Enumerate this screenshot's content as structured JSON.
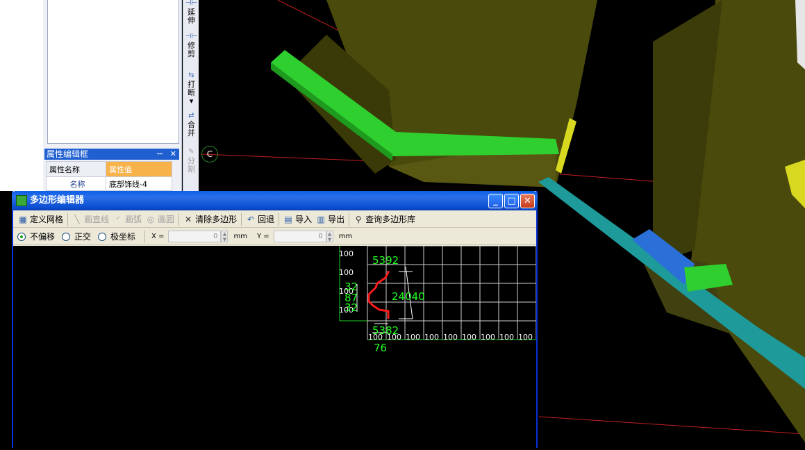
{
  "left_panel": {
    "prop_title": "属性编辑框",
    "prop_pin": "ᅲ",
    "prop_close": "✕",
    "table_headers": [
      "属性名称",
      "属性值"
    ],
    "rows": [
      {
        "name": "名称",
        "value": "底部饰线-4"
      }
    ]
  },
  "vertical_tools": [
    {
      "icon": "extend-icon",
      "label": "延\n伸",
      "disabled": false
    },
    {
      "icon": "trim-icon",
      "label": "修\n剪",
      "disabled": false
    },
    {
      "icon": "break-icon",
      "label": "打\n断\n▾",
      "disabled": false
    },
    {
      "icon": "merge-icon",
      "label": "合\n并",
      "disabled": false
    },
    {
      "icon": "split-icon",
      "label": "分\n割",
      "disabled": true
    }
  ],
  "osnap_label": "C",
  "dialog": {
    "title": "多边形编辑器",
    "toolbar": [
      {
        "label": "定义网格",
        "icon": "grid-icon",
        "disabled": false
      },
      {
        "label": "画直线",
        "icon": "line-icon",
        "disabled": true
      },
      {
        "label": "画弧",
        "icon": "arc-icon",
        "disabled": true
      },
      {
        "label": "画圆",
        "icon": "circle-icon",
        "disabled": true
      },
      {
        "label": "清除多边形",
        "icon": "clear-icon",
        "disabled": false
      },
      {
        "label": "回退",
        "icon": "undo-icon",
        "disabled": false
      },
      {
        "label": "导入",
        "icon": "import-icon",
        "disabled": false
      },
      {
        "label": "导出",
        "icon": "export-icon",
        "disabled": false
      },
      {
        "label": "查询多边形库",
        "icon": "search-icon",
        "disabled": false
      }
    ],
    "options": {
      "radios": [
        {
          "label": "不偏移",
          "checked": true
        },
        {
          "label": "正交",
          "checked": false
        },
        {
          "label": "极坐标",
          "checked": false
        }
      ],
      "x_label": "X =",
      "x_value": "0",
      "y_label": "Y =",
      "y_value": "0",
      "unit": "mm"
    },
    "canvas": {
      "grid_spacing_labels_x": [
        "100",
        "100",
        "100",
        "100",
        "100",
        "100",
        "100",
        "100",
        "100"
      ],
      "grid_spacing_labels_y": [
        "100",
        "100",
        "100",
        "100"
      ],
      "dim_top": "5392",
      "dim_left": [
        "32",
        "87",
        "32"
      ],
      "dim_right": "24040",
      "dim_bottom_a": "5382",
      "dim_bottom_b": "76"
    }
  },
  "colors": {
    "profile": "#ff1a1a",
    "dims": "#22ff22",
    "grid": "#cfcfcf"
  }
}
